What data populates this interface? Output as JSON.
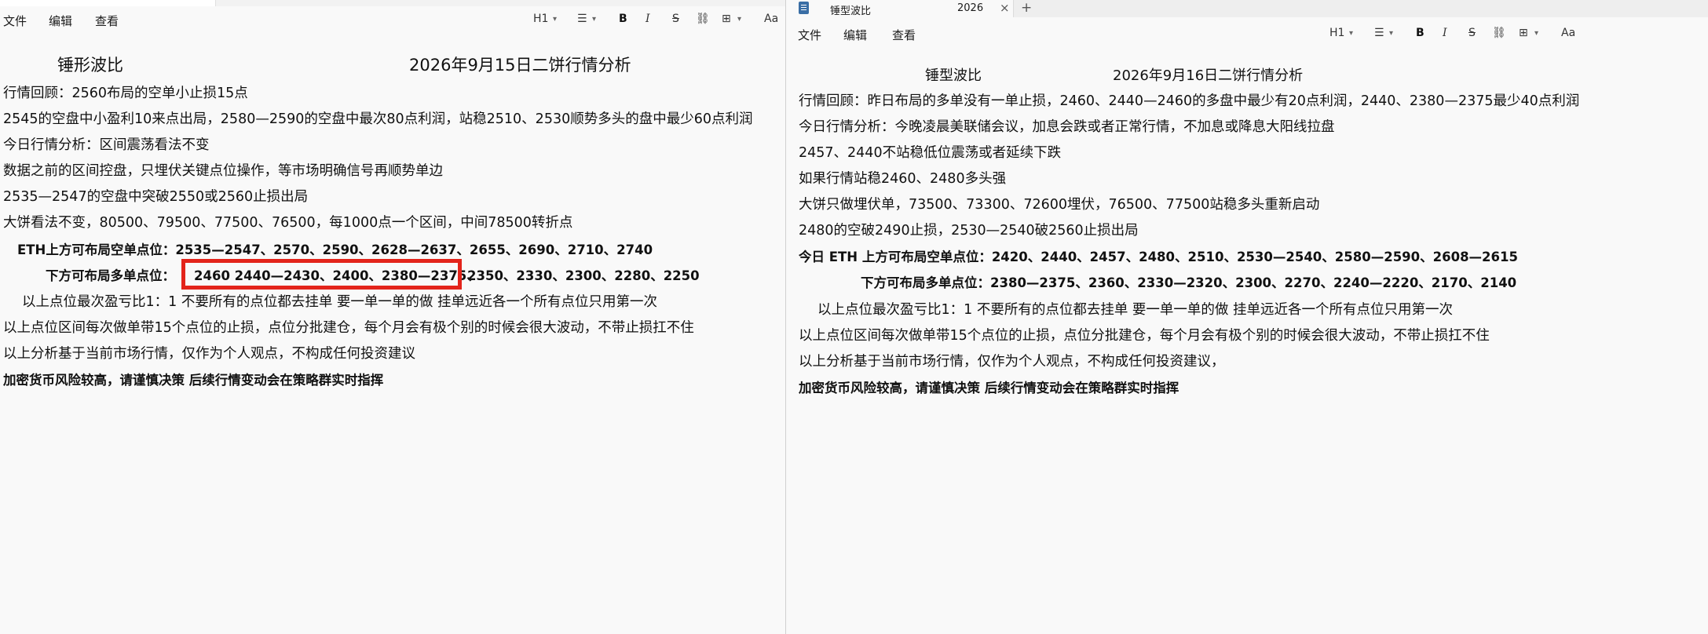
{
  "left": {
    "menu": [
      "文件",
      "编辑",
      "查看"
    ],
    "toolbar": {
      "heading": "H1",
      "list_icon": "list-icon",
      "bold": "B",
      "italic": "I",
      "strike": "S",
      "link_icon": "link-icon",
      "table_icon": "table-icon",
      "clear_format_icon": "clear-format-icon"
    },
    "doc": {
      "title_left": "锤形波比",
      "title_right": "2026年9月15日二饼行情分析",
      "lines": [
        "行情回顾：2560布局的空单小止损15点",
        "2545的空盘中小盈利10来点出局，2580—2590的空盘中最次80点利润，站稳2510、2530顺势多头的盘中最少60点利润",
        "今日行情分析：区间震荡看法不变",
        "数据之前的区间控盘，只埋伏关键点位操作，等市场明确信号再顺势单边",
        "2535—2547的空盘中突破2550或2560止损出局",
        "大饼看法不变，80500、79500、77500、76500，每1000点一个区间，中间78500转折点"
      ],
      "short_levels": "ETH上方可布局空单点位：2535—2547、2570、2590、2628—2637、2655、2690、2710、2740",
      "long_label": "下方可布局多单点位：",
      "long_highlighted": "2460 2440—2430、2400、2380—2375、",
      "long_rest": "2350、2330、2300、2280、2250",
      "ratio_line": "以上点位最次盈亏比1：1      不要所有的点位都去挂单  要一单一单的做 挂单远近各一个所有点位只用第一次",
      "stop_line": "以上点位区间每次做单带15个点位的止损，点位分批建仓，每个月会有极个别的时候会很大波动，不带止损扛不住",
      "disclaimer": "以上分析基于当前市场行情，仅作为个人观点，不构成任何投资建议",
      "risk": "加密货币风险较高，请谨慎决策 后续行情变动会在策略群实时指挥"
    }
  },
  "right": {
    "tab": {
      "title": "锤型波比",
      "title_suffix": "2026",
      "close": "×",
      "new_tab": "+"
    },
    "menu": [
      "文件",
      "编辑",
      "查看"
    ],
    "toolbar": {
      "heading": "H1",
      "bold": "B",
      "italic": "I",
      "strike": "S"
    },
    "doc": {
      "title_left": "锤型波比",
      "title_right": "2026年9月16日二饼行情分析",
      "lines": [
        "行情回顾：昨日布局的多单没有一单止损，2460、2440—2460的多盘中最少有20点利润，2440、2380—2375最少40点利润",
        "今日行情分析：今晚凌晨美联储会议，加息会跌或者正常行情，不加息或降息大阳线拉盘",
        "2457、2440不站稳低位震荡或者延续下跌",
        "如果行情站稳2460、2480多头强",
        "大饼只做埋伏单，73500、73300、72600埋伏，76500、77500站稳多头重新启动",
        "2480的空破2490止损，2530—2540破2560止损出局"
      ],
      "short_levels": "今日 ETH 上方可布局空单点位：2420、2440、2457、2480、2510、2530—2540、2580—2590、2608—2615",
      "long_levels": "下方可布局多单点位：2380—2375、2360、2330—2320、2300、2270、2240—2220、2170、2140",
      "ratio_line": "以上点位最次盈亏比1：1       不要所有的点位都去挂单  要一单一单的做 挂单远近各一个所有点位只用第一次",
      "stop_line": "以上点位区间每次做单带15个点位的止损，点位分批建仓，每个月会有极个别的时候会很大波动，不带止损扛不住",
      "disclaimer": "以上分析基于当前市场行情，仅作为个人观点，不构成任何投资建议，",
      "risk": "加密货币风险较高，请谨慎决策 后续行情变动会在策略群实时指挥"
    }
  },
  "colors": {
    "highlight_border": "#e3241b",
    "background": "#f9f9f9"
  }
}
